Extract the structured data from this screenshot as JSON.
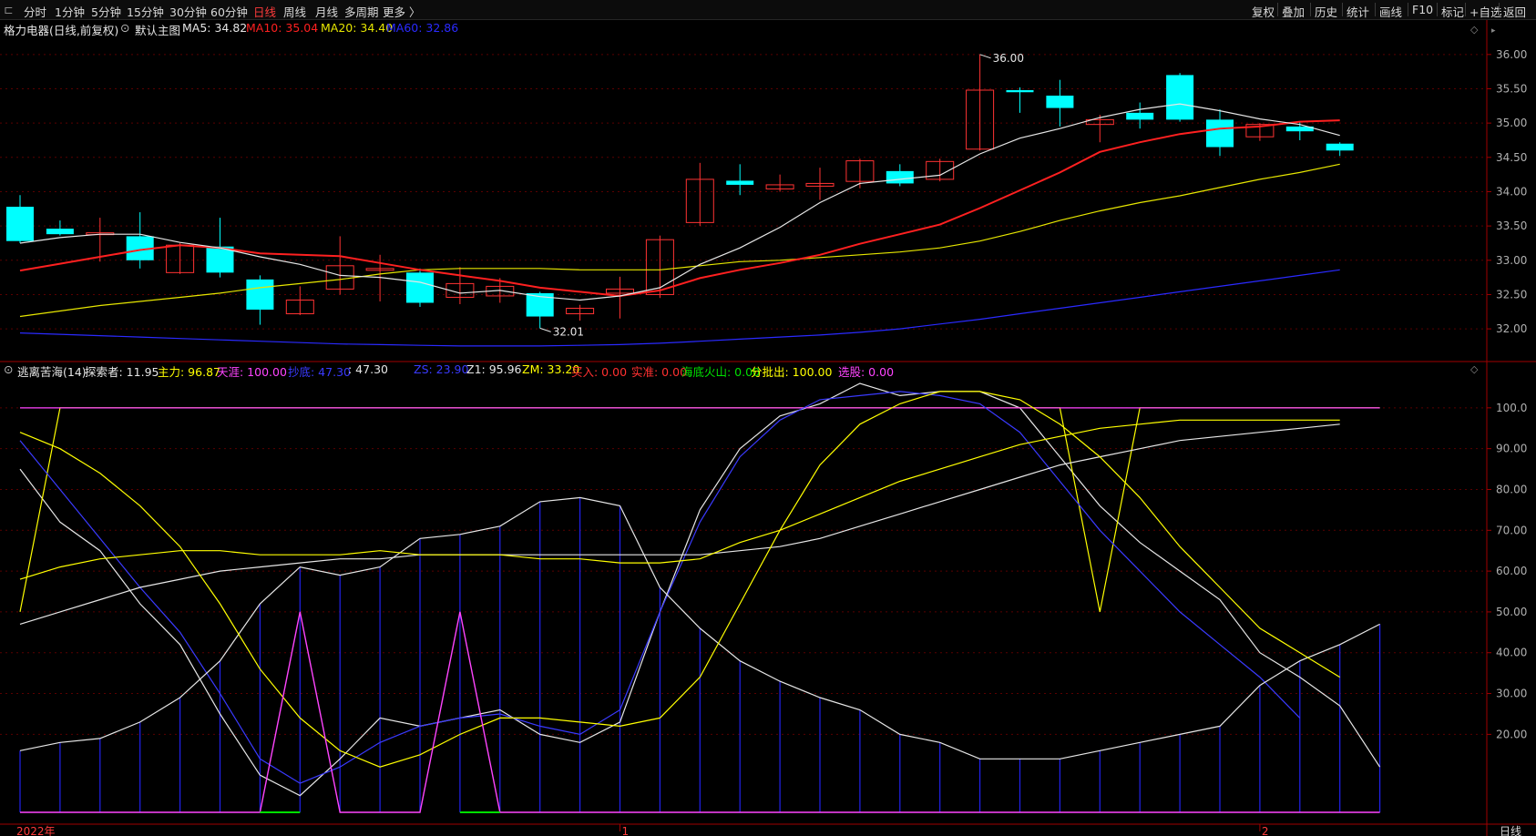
{
  "toolbar": {
    "timeframes": [
      "分时",
      "1分钟",
      "5分钟",
      "15分钟",
      "30分钟",
      "60分钟",
      "日线",
      "周线",
      "月线",
      "多周期",
      "更多 〉"
    ],
    "active_timeframe": "日线",
    "right_buttons": [
      "复权",
      "叠加",
      "历史",
      "统计",
      "画线",
      "F10",
      "标记",
      "+自选",
      "返回"
    ]
  },
  "main_info": {
    "stock": "格力电器(日线,前复权)",
    "template": "默认主图",
    "ma5": "MA5: 34.82",
    "ma10": "MA10: 35.04",
    "ma20": "MA20: 34.40",
    "ma60": "MA60: 32.86"
  },
  "indicator_info": {
    "name": "逃离苦海(14)",
    "items": [
      {
        "text": "探索者: 11.95",
        "color": "#e6e6e6"
      },
      {
        "text": "主力: 96.87",
        "color": "#ffff00"
      },
      {
        "text": "天涯: 100.00",
        "color": "#ff44ff"
      },
      {
        "text": "抄底: 47.30",
        "color": "#3a3aff"
      },
      {
        "text": ": 47.30",
        "color": "#e6e6e6"
      },
      {
        "text": "ZS: 23.90",
        "color": "#3a3aff"
      },
      {
        "text": "Z1: 95.96",
        "color": "#e6e6e6"
      },
      {
        "text": "ZM: 33.20",
        "color": "#ffff00"
      },
      {
        "text": "买入: 0.00",
        "color": "#ff3030"
      },
      {
        "text": "实准: 0.00",
        "color": "#ff3030"
      },
      {
        "text": "海底火山: 0.00",
        "color": "#00e000"
      },
      {
        "text": "分批出: 100.00",
        "color": "#ffff00"
      },
      {
        "text": "选股: 0.00",
        "color": "#ff44ff"
      }
    ]
  },
  "bottom_axis": {
    "year_label": "2022年",
    "month_labels": [
      "1",
      "2"
    ],
    "period_label": "日线"
  },
  "colors": {
    "up": "#ff3333",
    "down": "#00ffff",
    "ma5": "#e6e6e6",
    "ma10": "#ff2020",
    "ma20": "#e6e600",
    "ma60": "#2a2aff",
    "grid": "#5a0000",
    "axis": "#a00000"
  },
  "chart_data": [
    {
      "type": "candlestick",
      "title": "格力电器(日线,前复权)",
      "y_ticks": [
        "36.00",
        "35.50",
        "35.00",
        "34.50",
        "34.00",
        "33.50",
        "33.00",
        "32.50",
        "32.00"
      ],
      "ylim": [
        31.55,
        36.25
      ],
      "annotations": [
        {
          "text": "36.00",
          "index": 24,
          "value": 36.0
        },
        {
          "text": "32.01",
          "index": 13,
          "value": 32.01
        }
      ],
      "candles": [
        {
          "o": 33.78,
          "h": 33.95,
          "l": 33.25,
          "c": 33.28
        },
        {
          "o": 33.46,
          "h": 33.58,
          "l": 33.36,
          "c": 33.38
        },
        {
          "o": 33.38,
          "h": 33.62,
          "l": 32.98,
          "c": 33.4
        },
        {
          "o": 33.35,
          "h": 33.7,
          "l": 32.88,
          "c": 33.0
        },
        {
          "o": 32.82,
          "h": 33.25,
          "l": 32.8,
          "c": 33.22
        },
        {
          "o": 33.2,
          "h": 33.62,
          "l": 32.75,
          "c": 32.82
        },
        {
          "o": 32.72,
          "h": 32.78,
          "l": 32.06,
          "c": 32.28
        },
        {
          "o": 32.22,
          "h": 32.62,
          "l": 32.2,
          "c": 32.42
        },
        {
          "o": 32.58,
          "h": 33.35,
          "l": 32.5,
          "c": 32.92
        },
        {
          "o": 32.88,
          "h": 33.08,
          "l": 32.4,
          "c": 32.88
        },
        {
          "o": 32.82,
          "h": 32.88,
          "l": 32.32,
          "c": 32.38
        },
        {
          "o": 32.46,
          "h": 32.9,
          "l": 32.36,
          "c": 32.66
        },
        {
          "o": 32.48,
          "h": 32.74,
          "l": 32.38,
          "c": 32.62
        },
        {
          "o": 32.52,
          "h": 32.54,
          "l": 32.01,
          "c": 32.18
        },
        {
          "o": 32.22,
          "h": 32.35,
          "l": 32.12,
          "c": 32.3
        },
        {
          "o": 32.52,
          "h": 32.76,
          "l": 32.15,
          "c": 32.58
        },
        {
          "o": 32.5,
          "h": 33.36,
          "l": 32.45,
          "c": 33.3
        },
        {
          "o": 33.55,
          "h": 34.42,
          "l": 33.5,
          "c": 34.18
        },
        {
          "o": 34.16,
          "h": 34.4,
          "l": 33.95,
          "c": 34.1
        },
        {
          "o": 34.04,
          "h": 34.25,
          "l": 34.0,
          "c": 34.1
        },
        {
          "o": 34.08,
          "h": 34.35,
          "l": 33.88,
          "c": 34.12
        },
        {
          "o": 34.15,
          "h": 34.48,
          "l": 34.05,
          "c": 34.45
        },
        {
          "o": 34.3,
          "h": 34.4,
          "l": 34.08,
          "c": 34.12
        },
        {
          "o": 34.18,
          "h": 34.48,
          "l": 34.15,
          "c": 34.44
        },
        {
          "o": 34.62,
          "h": 36.0,
          "l": 34.6,
          "c": 35.48
        },
        {
          "o": 35.48,
          "h": 35.52,
          "l": 35.15,
          "c": 35.45
        },
        {
          "o": 35.4,
          "h": 35.63,
          "l": 34.95,
          "c": 35.22
        },
        {
          "o": 34.98,
          "h": 35.12,
          "l": 34.72,
          "c": 35.05
        },
        {
          "o": 35.15,
          "h": 35.3,
          "l": 34.92,
          "c": 35.05
        },
        {
          "o": 35.7,
          "h": 35.73,
          "l": 35.02,
          "c": 35.05
        },
        {
          "o": 35.05,
          "h": 35.2,
          "l": 34.52,
          "c": 34.65
        },
        {
          "o": 34.8,
          "h": 35.0,
          "l": 34.74,
          "c": 34.98
        },
        {
          "o": 34.95,
          "h": 35.02,
          "l": 34.75,
          "c": 34.88
        },
        {
          "o": 34.7,
          "h": 34.72,
          "l": 34.52,
          "c": 34.6
        }
      ],
      "ma5": [
        33.25,
        33.33,
        33.38,
        33.38,
        33.26,
        33.18,
        33.05,
        32.94,
        32.78,
        32.75,
        32.68,
        32.52,
        32.56,
        32.47,
        32.42,
        32.48,
        32.6,
        32.94,
        33.18,
        33.48,
        33.84,
        34.12,
        34.18,
        34.24,
        34.55,
        34.78,
        34.92,
        35.08,
        35.2,
        35.28,
        35.18,
        35.06,
        34.98,
        34.82
      ],
      "ma10": [
        32.85,
        32.95,
        33.05,
        33.15,
        33.22,
        33.18,
        33.1,
        33.08,
        33.06,
        32.96,
        32.86,
        32.78,
        32.7,
        32.6,
        32.54,
        32.48,
        32.56,
        32.74,
        32.86,
        32.96,
        33.08,
        33.24,
        33.38,
        33.52,
        33.76,
        34.02,
        34.28,
        34.58,
        34.72,
        34.84,
        34.92,
        34.95,
        35.02,
        35.04
      ],
      "ma20": [
        32.18,
        32.26,
        32.34,
        32.4,
        32.46,
        32.52,
        32.6,
        32.66,
        32.72,
        32.8,
        32.86,
        32.88,
        32.88,
        32.88,
        32.86,
        32.86,
        32.86,
        32.92,
        32.98,
        33.0,
        33.04,
        33.08,
        33.12,
        33.18,
        33.28,
        33.42,
        33.58,
        33.72,
        33.84,
        33.94,
        34.06,
        34.18,
        34.28,
        34.4
      ],
      "ma60": [
        31.94,
        31.92,
        31.9,
        31.88,
        31.86,
        31.84,
        31.82,
        31.8,
        31.78,
        31.77,
        31.76,
        31.75,
        31.75,
        31.75,
        31.76,
        31.77,
        31.79,
        31.82,
        31.85,
        31.88,
        31.91,
        31.95,
        32.0,
        32.07,
        32.14,
        32.22,
        32.3,
        32.38,
        32.46,
        32.54,
        32.62,
        32.7,
        32.78,
        32.86
      ]
    },
    {
      "type": "line",
      "title": "逃离苦海(14)",
      "y_ticks": [
        "100.0",
        "90.00",
        "80.00",
        "70.00",
        "60.00",
        "50.00",
        "40.00",
        "30.00",
        "20.00"
      ],
      "ylim": [
        0,
        108
      ],
      "series": [
        {
          "name": "探索者",
          "color": "#e6e6e6",
          "values": [
            85,
            72,
            65,
            52,
            42,
            25,
            10,
            5,
            14,
            24,
            22,
            24,
            26,
            20,
            18,
            23,
            50,
            75,
            90,
            98,
            101,
            106,
            103,
            104,
            104,
            100,
            88,
            76,
            67,
            60,
            53,
            40,
            34,
            27,
            12
          ]
        },
        {
          "name": "主力",
          "color": "#ffff00",
          "values": [
            50,
            100,
            100,
            100,
            100,
            100,
            100,
            100,
            100,
            100,
            100,
            100,
            100,
            100,
            100,
            100,
            100,
            100,
            100,
            100,
            100,
            100,
            100,
            100,
            100,
            100,
            100,
            50,
            100,
            100,
            100,
            100,
            100,
            100,
            100
          ]
        },
        {
          "name": "天涯",
          "color": "#ff44ff",
          "values": [
            100,
            100,
            100,
            100,
            100,
            100,
            100,
            100,
            100,
            100,
            100,
            100,
            100,
            100,
            100,
            100,
            100,
            100,
            100,
            100,
            100,
            100,
            100,
            100,
            100,
            100,
            100,
            100,
            100,
            100,
            100,
            100,
            100,
            100,
            100
          ]
        },
        {
          "name": "抄底",
          "color": "#3a3aff",
          "values": [
            92,
            80,
            68,
            56,
            45,
            30,
            14,
            8,
            12,
            18,
            22,
            24,
            25,
            22,
            20,
            26,
            50,
            72,
            88,
            97,
            102,
            103,
            104,
            103,
            101,
            94,
            82,
            70,
            60,
            50,
            42,
            34,
            24
          ]
        },
        {
          "name": "ZS",
          "color": "#e6e6e6",
          "values": [
            47,
            50,
            53,
            56,
            58,
            60,
            61,
            62,
            63,
            63,
            64,
            64,
            64,
            64,
            64,
            64,
            64,
            64,
            65,
            66,
            68,
            71,
            74,
            77,
            80,
            83,
            86,
            88,
            90,
            92,
            93,
            94,
            95,
            96
          ]
        },
        {
          "name": "Z1",
          "color": "#e6e6e6",
          "values": [
            16,
            18,
            19,
            23,
            29,
            38,
            52,
            61,
            59,
            61,
            68,
            69,
            71,
            77,
            78,
            76,
            56,
            46,
            38,
            33,
            29,
            26,
            20,
            18,
            14,
            14,
            14,
            16,
            18,
            20,
            22,
            32,
            38,
            42,
            47
          ]
        },
        {
          "name": "ZM",
          "color": "#ffff00",
          "values": [
            94,
            90,
            84,
            76,
            66,
            52,
            36,
            24,
            16,
            12,
            15,
            20,
            24,
            24,
            23,
            22,
            24,
            34,
            52,
            70,
            86,
            96,
            101,
            104,
            104,
            102,
            96,
            88,
            78,
            66,
            56,
            46,
            40,
            34
          ]
        },
        {
          "name": "分批出",
          "color": "#ffff00",
          "values": [
            58,
            61,
            63,
            64,
            65,
            65,
            64,
            64,
            64,
            65,
            64,
            64,
            64,
            63,
            63,
            62,
            62,
            63,
            67,
            70,
            74,
            78,
            82,
            85,
            88,
            91,
            93,
            95,
            96,
            97,
            97,
            97,
            97,
            97
          ]
        },
        {
          "name": "买入",
          "color": "#ff44ff",
          "values": [
            0,
            0,
            0,
            0,
            0,
            0,
            0,
            50,
            0,
            0,
            0,
            50,
            0,
            0,
            0,
            0,
            0,
            0,
            0,
            0,
            0,
            0,
            0,
            0,
            0,
            0,
            0,
            0,
            0,
            0,
            0,
            0,
            0,
            0,
            0
          ]
        },
        {
          "name": "海底火山",
          "color": "#00e000",
          "values": [
            0,
            0,
            0,
            0,
            0,
            0,
            1,
            1,
            0,
            0,
            0,
            1,
            1,
            0,
            0,
            0,
            0,
            0,
            0,
            0,
            0,
            0,
            0,
            0,
            0,
            0,
            0,
            0,
            0,
            0,
            0,
            0,
            0,
            0,
            0
          ]
        }
      ],
      "bars": [
        16,
        18,
        19,
        23,
        29,
        38,
        52,
        61,
        59,
        61,
        68,
        69,
        71,
        77,
        78,
        76,
        56,
        46,
        38,
        33,
        29,
        26,
        20,
        18,
        14,
        14,
        14,
        16,
        18,
        20,
        22,
        32,
        38,
        42,
        47
      ]
    }
  ]
}
